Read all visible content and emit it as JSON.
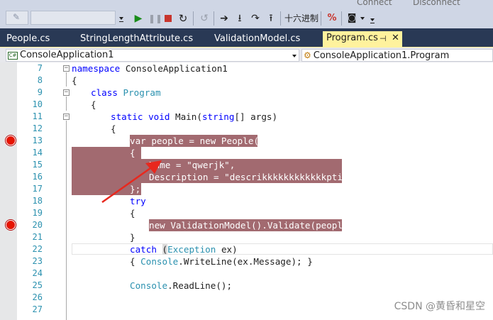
{
  "toolbar": {
    "hex_label": "十六进制",
    "connect_label": "Connect",
    "disconnect_label": "Disconnect"
  },
  "tabs": [
    {
      "label": "People.cs",
      "active": false
    },
    {
      "label": "StringLengthAttribute.cs",
      "active": false
    },
    {
      "label": "ValidationModel.cs",
      "active": false
    },
    {
      "label": "Program.cs",
      "active": true
    }
  ],
  "tab_icons": {
    "pin": "⊣",
    "close": "✕"
  },
  "navbar": {
    "project_dropdown": "ConsoleApplication1",
    "class_dropdown": "ConsoleApplication1.Program",
    "project_badge": "C#"
  },
  "line_numbers": [
    "7",
    "8",
    "9",
    "10",
    "11",
    "12",
    "13",
    "14",
    "15",
    "16",
    "17",
    "18",
    "19",
    "20",
    "21",
    "22",
    "23",
    "24",
    "25",
    "26",
    "27"
  ],
  "breakpoint_lines": [
    13,
    20
  ],
  "code": {
    "l7_kw": "namespace",
    "l7_name": " ConsoleApplication1",
    "l8": "{",
    "l9_kw": "class",
    "l9_name": "Program",
    "l10": "{",
    "l11_kw1": "static",
    "l11_kw2": "void",
    "l11_mid": " Main(",
    "l11_kw3": "string",
    "l11_end": "[] args)",
    "l12": "{",
    "l13_kw1": "var",
    "l13_mid": " people = ",
    "l13_kw2": "new",
    "l13_type": "People",
    "l13_end": "()",
    "l14": "{",
    "l15": "Name = \"qwerjk\",",
    "l16": "Description = \"descrikkkkkkkkkkkkption\"",
    "l17": "};",
    "l18_kw": "try",
    "l19": "{",
    "l20_kw": "new",
    "l20_type": "ValidationModel",
    "l20_end": "().Validate(people);",
    "l21": "}",
    "l22_kw": "catch",
    "l22_paren": "(",
    "l22_type": "Exception",
    "l22_end": " ex)",
    "l23_start": "{ ",
    "l23_type": "Console",
    "l23_end": ".WriteLine(ex.Message); }",
    "l25_type": "Console",
    "l25_end": ".ReadLine();"
  },
  "watermark": "CSDN @黄昏和星空",
  "colors": {
    "toolbar_bg": "#cfd6e5",
    "tabstrip_bg": "#293955",
    "active_tab_bg": "#fff29d",
    "breakpoint_highlight": "#a26a70",
    "breakpoint_dot": "#e51400",
    "keyword": "#0000ff",
    "type": "#2b91af",
    "line_number": "#2b91af"
  }
}
